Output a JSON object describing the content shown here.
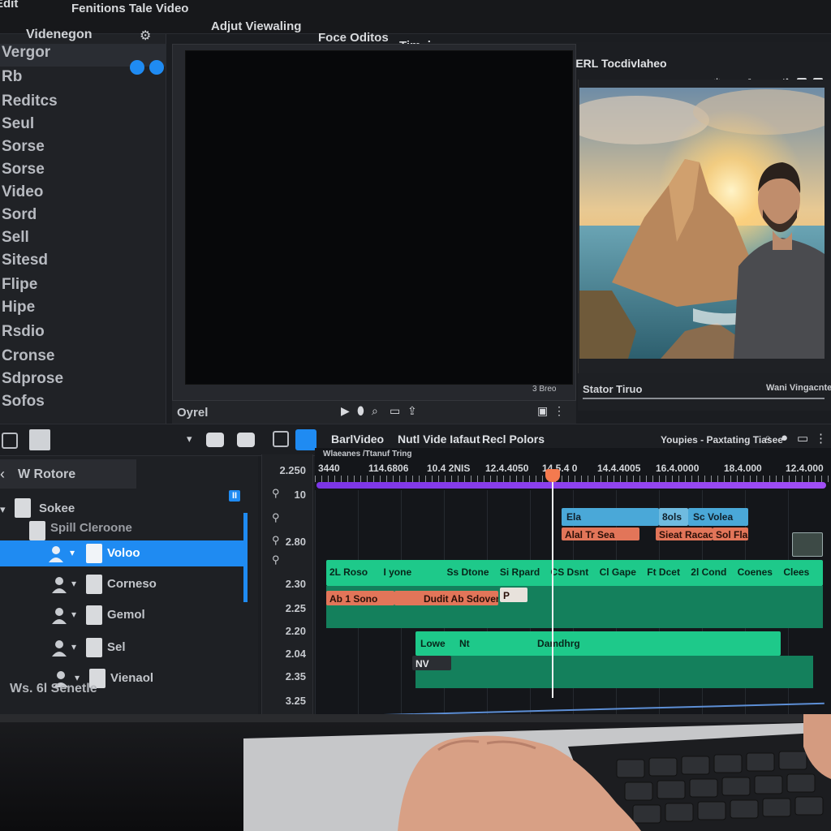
{
  "menu": {
    "items": [
      "Edit",
      "Fenitions Tale Video",
      "Adjut Viewaling",
      "Foce Oditos",
      "Timel"
    ],
    "window_title": "Valefus Tinos —VHERL Tocdivlaheo"
  },
  "library": {
    "header": "Videnegon",
    "items": [
      "Vergor",
      "Rb",
      "Reditcs",
      "Seul",
      "Sorse",
      "Sorse",
      "Video",
      "Sord",
      "Sell",
      "Sitesd",
      "Flipe",
      "Hipe",
      "Rsdio",
      "Cronse",
      "Sdprose",
      "Sofos"
    ]
  },
  "program": {
    "footer_label": "Oyrel",
    "counter": "3 Breo"
  },
  "source": {
    "title": "Stator Tiruo",
    "right_label": "Wani Vingacntel"
  },
  "toolbar": {
    "labels": [
      "BarlVideo",
      "Nutl Vide Iafaut",
      "Recl Polors"
    ],
    "right_label": "Youpies - Paxtating Tiasee"
  },
  "tree": {
    "header": "W Rotore",
    "root_folder": "Sokee",
    "sub_folder": "Spill Cleroone",
    "items": [
      "Voloo",
      "Corneso",
      "Gemol",
      "Sel",
      "Vienaol"
    ],
    "footer": "Ws. 6l Senetle",
    "badge": "II"
  },
  "tracks": {
    "labels": [
      "2.250",
      "10",
      "2.80",
      "2.30",
      "2.25",
      "2.20",
      "2.04",
      "2.35",
      "3.25",
      "0 0"
    ]
  },
  "timeline": {
    "title": "Wlaeanes /Ttanuf Tring",
    "ruler": [
      "3440",
      "114.6806",
      "10.4 2NIS",
      "12.4.4050",
      "14.5.4 0",
      "14.4.4005",
      "16.4.0000",
      "18.4.000",
      "12.4.000"
    ],
    "clips": {
      "v_top_1": "Ela",
      "v_top_2": "8ols",
      "v_top_3": "Sc Volea",
      "red_top_1": "Alal Tr Sea",
      "red_top_2": "Sieat Racao",
      "red_top_3": "Sol Flal",
      "green_1": "2L Roso",
      "green_2": "I yone",
      "green_3": "Ss Dtone",
      "green_4": "Si Rpard",
      "green_5": "CS Dsnt",
      "green_6": "Cl Gape",
      "green_7": "Ft Dcet",
      "green_8": "2l Cond",
      "green_9": "Coenes",
      "green_10": "Clees",
      "red_1": "Ab 1 Sono",
      "red_2": "Dudit Ab Sdoven",
      "red_3": "P",
      "green_lower_1": "Lowe",
      "green_lower_2": "Nt",
      "green_lower_3": "Damdhrg",
      "dark_clip": "NV"
    }
  },
  "colors": {
    "accent_blue": "#1f8bf2",
    "clip_green": "#1ec98a",
    "clip_green_dark": "#14805c",
    "clip_red": "#e27559",
    "clip_blue": "#4aa8d8",
    "playhead": "#f47a4f",
    "marker_purple": "#8c3ff0"
  }
}
